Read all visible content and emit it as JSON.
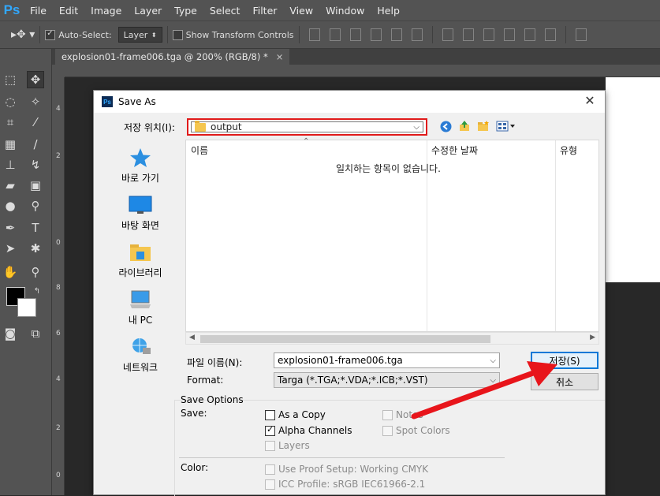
{
  "app": {
    "logo": "Ps",
    "menus": [
      "File",
      "Edit",
      "Image",
      "Layer",
      "Type",
      "Select",
      "Filter",
      "View",
      "Window",
      "Help"
    ]
  },
  "options_bar": {
    "auto_select_label": "Auto-Select:",
    "auto_select_target": "Layer",
    "show_transform_label": "Show Transform Controls"
  },
  "document_tab": {
    "title": "explosion01-frame006.tga @ 200% (RGB/8) *",
    "close": "×"
  },
  "rulers": {
    "vertical_marks": [
      "4",
      "2",
      "0",
      "8",
      "6",
      "4",
      "2",
      "0"
    ]
  },
  "dialog": {
    "title": "Save As",
    "close": "✕",
    "location_label": "저장 위치(I):",
    "location_value": "output",
    "places": [
      {
        "label": "바로 가기",
        "icon": "star-icon"
      },
      {
        "label": "바탕 화면",
        "icon": "desktop-icon"
      },
      {
        "label": "라이브러리",
        "icon": "library-icon"
      },
      {
        "label": "내 PC",
        "icon": "computer-icon"
      },
      {
        "label": "네트워크",
        "icon": "network-icon"
      }
    ],
    "columns": [
      "이름",
      "수정한 날짜",
      "유형"
    ],
    "empty_message": "일치하는 항목이 없습니다.",
    "filename_label": "파일 이름(N):",
    "filename_value": "explosion01-frame006.tga",
    "format_label": "Format:",
    "format_value": "Targa (*.TGA;*.VDA;*.ICB;*.VST)",
    "save_button": "저장(S)",
    "cancel_button": "취소",
    "save_options_title": "Save Options",
    "save_label": "Save:",
    "options": {
      "as_a_copy": {
        "label": "As a Copy",
        "checked": false,
        "enabled": true
      },
      "alpha_channels": {
        "label": "Alpha Channels",
        "checked": true,
        "enabled": true
      },
      "layers": {
        "label": "Layers",
        "checked": false,
        "enabled": false
      },
      "notes": {
        "label": "Notes",
        "checked": false,
        "enabled": false
      },
      "spot_colors": {
        "label": "Spot Colors",
        "checked": false,
        "enabled": false
      }
    },
    "color_label": "Color:",
    "proof_setup": {
      "label": "Use Proof Setup:  Working CMYK",
      "checked": false,
      "enabled": false
    },
    "icc_profile": {
      "label": "ICC Profile:  sRGB IEC61966-2.1",
      "checked": false,
      "enabled": false
    }
  },
  "colors": {
    "highlight_red": "#e01a1a",
    "ps_blue": "#31a8ff",
    "chrome": "#535353",
    "canvas_bg": "#282828"
  }
}
